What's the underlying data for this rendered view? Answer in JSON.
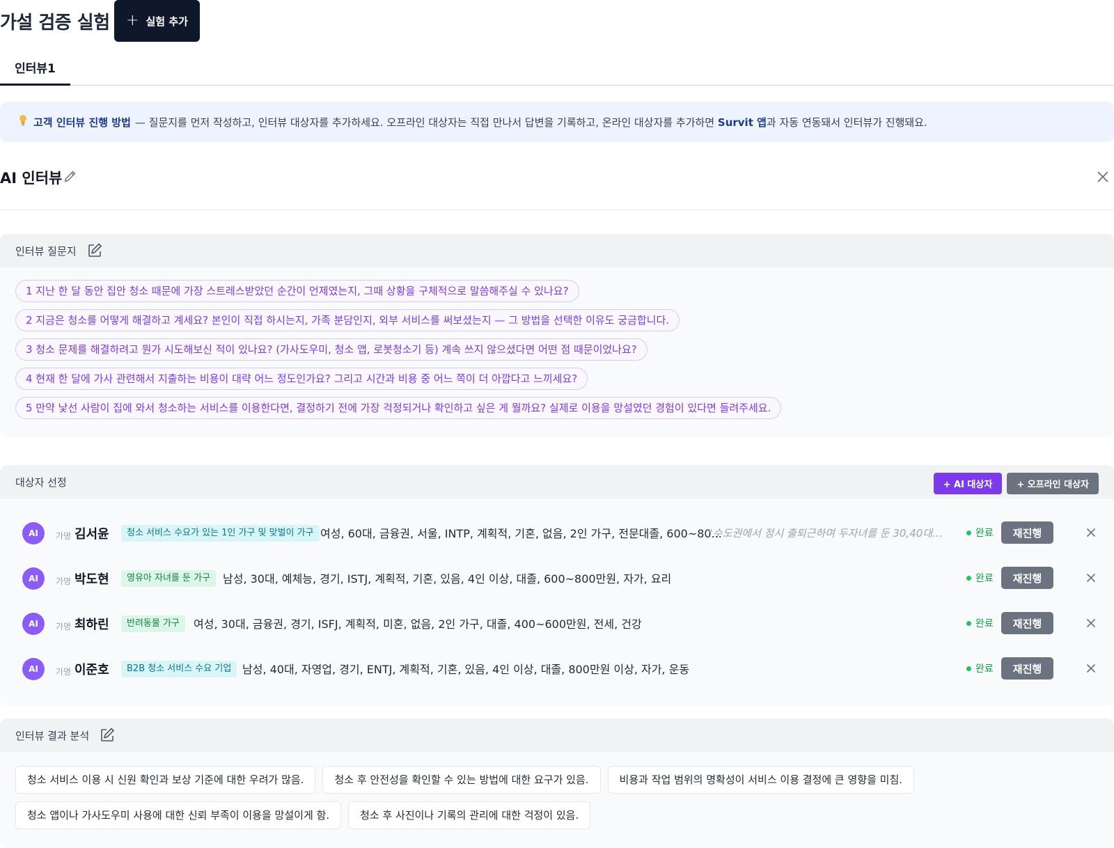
{
  "header": {
    "title": "가설 검증 실험",
    "add_button": "실험 추가"
  },
  "tabs": [
    {
      "label": "인터뷰1",
      "active": true
    }
  ],
  "tip": {
    "head": "고객 인터뷰 진행 방법",
    "body1": "— 질문지를 먼저 작성하고, 인터뷰 대상자를 추가하세요. 오프라인 대상자는 직접 만나서 답변을 기록하고, 온라인 대상자를 추가하면",
    "brand": "Survit 앱",
    "body2": "과 자동 연동돼서 인터뷰가 진행돼요."
  },
  "ai_interview": {
    "title": "AI 인터뷰"
  },
  "questions": {
    "title": "인터뷰 질문지",
    "items": [
      "1 지난 한 달 동안 집안 청소 때문에 가장 스트레스받았던 순간이 언제였는지, 그때 상황을 구체적으로 말씀해주실 수 있나요?",
      "2 지금은 청소를 어떻게 해결하고 계세요? 본인이 직접 하시는지, 가족 분담인지, 외부 서비스를 써보셨는지 — 그 방법을 선택한 이유도 궁금합니다.",
      "3 청소 문제를 해결하려고 뭔가 시도해보신 적이 있나요? (가사도우미, 청소 앱, 로봇청소기 등) 계속 쓰지 않으셨다면 어떤 점 때문이었나요?",
      "4 현재 한 달에 가사 관련해서 지출하는 비용이 대략 어느 정도인가요? 그리고 시간과 비용 중 어느 쪽이 더 아깝다고 느끼세요?",
      "5 만약 낯선 사람이 집에 와서 청소하는 서비스를 이용한다면, 결정하기 전에 가장 걱정되거나 확인하고 싶은 게 뭘까요? 실제로 이용을 망설였던 경험이 있다면 들려주세요."
    ]
  },
  "targets": {
    "title": "대상자 선정",
    "add_ai": "+ AI 대상자",
    "add_offline": "+ 오프라인 대상자",
    "rows": [
      {
        "avatar": "AI",
        "alias": "가명",
        "name": "김서윤",
        "segment": "청소 서비스 수요가 있는 1인 가구 및 맞벌이 가구",
        "seg_color": "cyan",
        "attrs": "여성, 60대, 금융권, 서울, INTP, 계획적, 기혼, 없음, 2인 가구, 전문대졸, 600~80...",
        "quote": "\"수도권에서 정시 출퇴근하며 두자녀를 둔 30,40대 ...",
        "status": "완료",
        "rerun": "재진행"
      },
      {
        "avatar": "AI",
        "alias": "가명",
        "name": "박도현",
        "segment": "영유아 자녀를 둔 가구",
        "seg_color": "green",
        "attrs": "남성, 30대, 예체능, 경기, ISTJ, 계획적, 기혼, 있음, 4인 이상, 대졸, 600~800만원, 자가, 요리",
        "quote": "",
        "status": "완료",
        "rerun": "재진행"
      },
      {
        "avatar": "AI",
        "alias": "가명",
        "name": "최하린",
        "segment": "반려동물 가구",
        "seg_color": "green",
        "attrs": "여성, 30대, 금융권, 경기, ISFJ, 계획적, 미혼, 없음, 2인 가구, 대졸, 400~600만원, 전세, 건강",
        "quote": "",
        "status": "완료",
        "rerun": "재진행"
      },
      {
        "avatar": "AI",
        "alias": "가명",
        "name": "이준호",
        "segment": "B2B 청소 서비스 수요 기업",
        "seg_color": "cyan",
        "attrs": "남성, 40대, 자영업, 경기, ENTJ, 계획적, 기혼, 있음, 4인 이상, 대졸, 800만원 이상, 자가, 운동",
        "quote": "",
        "status": "완료",
        "rerun": "재진행"
      }
    ]
  },
  "results": {
    "title": "인터뷰 결과 분석",
    "items": [
      "청소 서비스 이용 시 신원 확인과 보상 기준에 대한 우려가 많음.",
      "청소 후 안전성을 확인할 수 있는 방법에 대한 요구가 있음.",
      "비용과 작업 범위의 명확성이 서비스 이용 결정에 큰 영향을 미침.",
      "청소 앱이나 가사도우미 사용에 대한 신뢰 부족이 이용을 망설이게 함.",
      "청소 후 사진이나 기록의 관리에 대한 걱정이 있음."
    ]
  },
  "colors": {
    "accent": "#7c3aed",
    "dark": "#0f172a",
    "success": "#16a34a",
    "muted_button": "#6b7280"
  },
  "icons": [
    "plus-icon",
    "lightbulb-icon",
    "pencil-icon",
    "close-icon",
    "edit-square-icon"
  ]
}
